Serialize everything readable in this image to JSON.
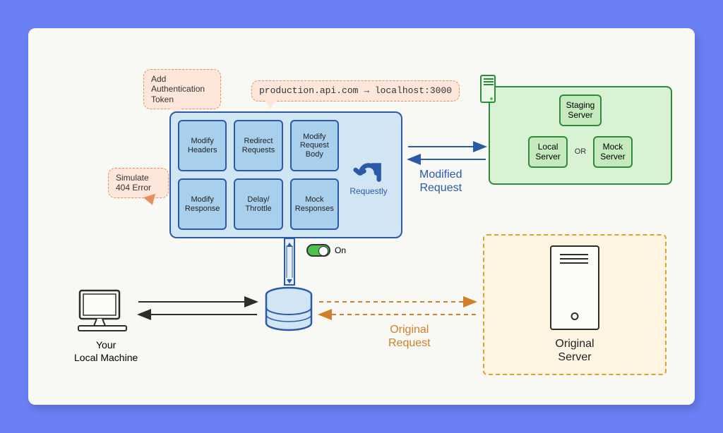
{
  "speech_bubbles": {
    "auth": "Add\nAuthentication\nToken",
    "redirect_example": "production.api.com → localhost:3000",
    "simulate_404": "Simulate\n404 Error"
  },
  "proxy": {
    "rules": [
      "Modify Headers",
      "Redirect Requests",
      "Modify Request Body",
      "Modify Response",
      "Delay/ Throttle",
      "Mock Responses"
    ],
    "brand": "Requestly"
  },
  "toggle": {
    "state": "On"
  },
  "flows": {
    "modified": "Modified\nRequest",
    "original": "Original\nRequest"
  },
  "local_machine": "Your\nLocal Machine",
  "target_servers": {
    "staging": "Staging\nServer",
    "local": "Local\nServer",
    "mock": "Mock\nServer",
    "or": "OR"
  },
  "original_server": "Original\nServer"
}
